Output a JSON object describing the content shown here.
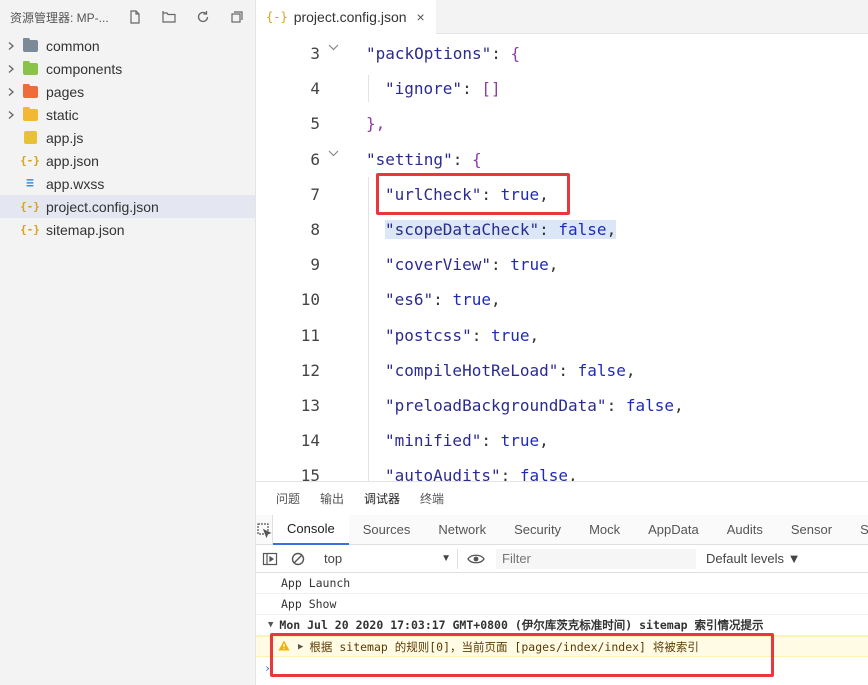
{
  "sidebar": {
    "title": "资源管理器: MP-...",
    "tree": [
      {
        "label": "common",
        "type": "folder",
        "color": "#7b8a96",
        "expandable": true
      },
      {
        "label": "components",
        "type": "folder",
        "color": "#8bc34a",
        "expandable": true
      },
      {
        "label": "pages",
        "type": "folder",
        "color": "#f06b3a",
        "expandable": true
      },
      {
        "label": "static",
        "type": "folder",
        "color": "#f2b833",
        "expandable": true
      },
      {
        "label": "app.js",
        "type": "js-file",
        "expandable": false
      },
      {
        "label": "app.json",
        "type": "json-file",
        "expandable": false
      },
      {
        "label": "app.wxss",
        "type": "css-file",
        "expandable": false
      },
      {
        "label": "project.config.json",
        "type": "json-file",
        "expandable": false,
        "selected": true
      },
      {
        "label": "sitemap.json",
        "type": "json-file",
        "expandable": false
      }
    ]
  },
  "tab": {
    "icon": "{-}",
    "title": "project.config.json",
    "close": "×"
  },
  "editor": {
    "lines": [
      {
        "num": "3",
        "fold": true,
        "indent": 0,
        "key": "\"packOptions\"",
        "rest": ": ",
        "brace": "{"
      },
      {
        "num": "4",
        "fold": false,
        "indent": 1,
        "key": "\"ignore\"",
        "rest": ": ",
        "brace": "[]"
      },
      {
        "num": "5",
        "fold": false,
        "indent": 0,
        "key": "",
        "rest": "",
        "brace": "},"
      },
      {
        "num": "6",
        "fold": true,
        "indent": 0,
        "key": "\"setting\"",
        "rest": ": ",
        "brace": "{"
      },
      {
        "num": "7",
        "fold": false,
        "indent": 1,
        "key": "\"urlCheck\"",
        "rest": ": ",
        "value": "true",
        "tail": ","
      },
      {
        "num": "8",
        "fold": false,
        "indent": 1,
        "key": "\"scopeDataCheck\"",
        "rest": ": ",
        "value": "false",
        "tail": ",",
        "highlight": true
      },
      {
        "num": "9",
        "fold": false,
        "indent": 1,
        "key": "\"coverView\"",
        "rest": ": ",
        "value": "true",
        "tail": ","
      },
      {
        "num": "10",
        "fold": false,
        "indent": 1,
        "key": "\"es6\"",
        "rest": ": ",
        "value": "true",
        "tail": ","
      },
      {
        "num": "11",
        "fold": false,
        "indent": 1,
        "key": "\"postcss\"",
        "rest": ": ",
        "value": "true",
        "tail": ","
      },
      {
        "num": "12",
        "fold": false,
        "indent": 1,
        "key": "\"compileHotReLoad\"",
        "rest": ": ",
        "value": "false",
        "tail": ","
      },
      {
        "num": "13",
        "fold": false,
        "indent": 1,
        "key": "\"preloadBackgroundData\"",
        "rest": ": ",
        "value": "false",
        "tail": ","
      },
      {
        "num": "14",
        "fold": false,
        "indent": 1,
        "key": "\"minified\"",
        "rest": ": ",
        "value": "true",
        "tail": ","
      },
      {
        "num": "15",
        "fold": false,
        "indent": 1,
        "key": "\"autoAudits\"",
        "rest": ": ",
        "value": "false",
        "tail": ","
      }
    ]
  },
  "panel": {
    "tabs": [
      "问题",
      "输出",
      "调试器",
      "终端"
    ],
    "active_tab": "调试器",
    "devtools_tabs": [
      "Console",
      "Sources",
      "Network",
      "Security",
      "Mock",
      "AppData",
      "Audits",
      "Sensor",
      "Storage"
    ],
    "active_devtools_tab": "Console",
    "context": "top",
    "filter_placeholder": "Filter",
    "levels": "Default levels ▼",
    "console": {
      "launch": "App Launch",
      "show": "App Show",
      "group": "Mon Jul 20 2020 17:03:17 GMT+0800 (伊尔库茨克标准时间) sitemap 索引情况提示",
      "warning": "根据 sitemap 的规则[0]，当前页面 [pages/index/index] 将被索引"
    }
  },
  "colors": {
    "annotation": "#e8383d",
    "selection": "#dbe7f6"
  }
}
